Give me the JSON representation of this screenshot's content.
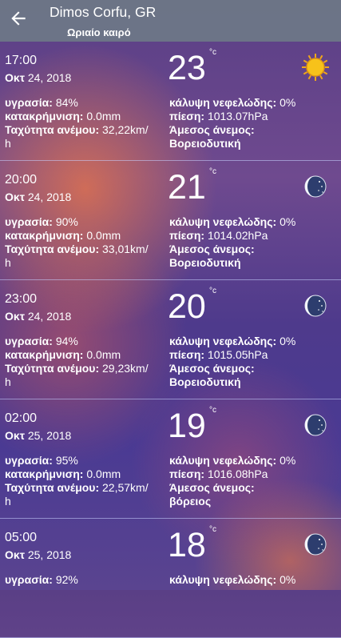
{
  "header": {
    "city": "Dimos Corfu, GR",
    "status": "Ωριαίο καιρό"
  },
  "labels": {
    "humidity": "υγρασία:",
    "precip": "κατακρήμνιση:",
    "wind_speed": "Ταχύτητα ανέμου:",
    "cloud": "κάλυψη νεφελώδης:",
    "pressure": "πίεση:",
    "wind_dir": "Άμεσος άνεμος:",
    "unit": "°c"
  },
  "forecast": [
    {
      "time": "17:00",
      "month": "Οκτ",
      "date": "24, 2018",
      "temp": "23",
      "humidity": "84%",
      "precip": "0.0mm",
      "wind": "32,22km/",
      "wind_unit": "h",
      "cloud": "0%",
      "pressure": "1013.07hPa",
      "direction": "Βορειοδυτική",
      "icon": "sun-icon"
    },
    {
      "time": "20:00",
      "month": "Οκτ",
      "date": "24, 2018",
      "temp": "21",
      "humidity": "90%",
      "precip": "0.0mm",
      "wind": "33,01km/",
      "wind_unit": "h",
      "cloud": "0%",
      "pressure": "1014.02hPa",
      "direction": "Βορειοδυτική",
      "icon": "moon-icon"
    },
    {
      "time": "23:00",
      "month": "Οκτ",
      "date": "24, 2018",
      "temp": "20",
      "humidity": "94%",
      "precip": "0.0mm",
      "wind": "29,23km/",
      "wind_unit": "h",
      "cloud": "0%",
      "pressure": "1015.05hPa",
      "direction": "Βορειοδυτική",
      "icon": "moon-icon"
    },
    {
      "time": "02:00",
      "month": "Οκτ",
      "date": "25, 2018",
      "temp": "19",
      "humidity": "95%",
      "precip": "0.0mm",
      "wind": "22,57km/",
      "wind_unit": "h",
      "cloud": "0%",
      "pressure": "1016.08hPa",
      "direction": "βόρειος",
      "icon": "moon-icon"
    },
    {
      "time": "05:00",
      "month": "Οκτ",
      "date": "25, 2018",
      "temp": "18",
      "humidity": "92%",
      "precip": "",
      "wind": "",
      "wind_unit": "",
      "cloud": "0%",
      "pressure": "",
      "direction": "",
      "icon": "moon-icon"
    }
  ]
}
